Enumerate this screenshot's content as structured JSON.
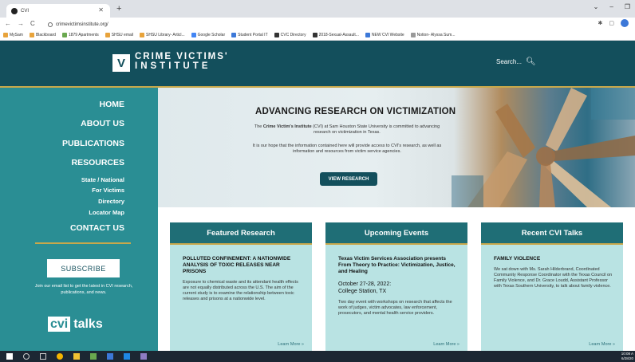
{
  "browser": {
    "tab_title": "CVI",
    "url": "crimevictimsinstitute.org/",
    "bookmarks": [
      "MySam",
      "Blackboard",
      "1879 Apartments",
      "SHSU email",
      "SHSU Library- Articl...",
      "Google Scholar",
      "Student Portal IT",
      "CVC Directory",
      "2018-Sexual-Assault...",
      "NEW CVI Website",
      "Notion- Alyssa Sum..."
    ]
  },
  "header": {
    "logo_line1": "CRIME VICTIMS'",
    "logo_line2": "INSTITUTE",
    "search_label": "Search..."
  },
  "sidebar": {
    "home": "HOME",
    "about": "ABOUT US",
    "publications": "PUBLICATIONS",
    "resources": "RESOURCES",
    "sub": [
      "State / National",
      "For Victims",
      "Directory",
      "Locator Map"
    ],
    "contact": "CONTACT US",
    "subscribe": "SUBSCRIBE",
    "join_text": "Join our email list to get the latest in CVI research, publications, and news.",
    "talks_logo_a": "cvi",
    "talks_logo_b": "talks"
  },
  "hero": {
    "title": "ADVANCING RESEARCH ON VICTIMIZATION",
    "line1_prefix": "The ",
    "line1_strong": "Crime Victim's Institute",
    "line1_suffix": " (CVI) at Sam Houston State University is committed to advancing research on victimization in Texas.",
    "line2": "It is our hope that the information contained here will provide access to CVI's research, as well as information and resources from victim service agencies.",
    "button": "VIEW RESEARCH"
  },
  "cards": {
    "featured": {
      "heading": "Featured Research",
      "title": "POLLUTED CONFINEMENT: A NATIONWIDE ANALYSIS OF TOXIC RELEASES NEAR PRISONS",
      "text": "Exposure to chemical waste and its attendant health effects are not equally distributed across the U.S. The aim of the current study is to examine the relationship between toxic releases and prisons at a nationwide level.",
      "link": "Learn More »"
    },
    "events": {
      "heading": "Upcoming Events",
      "title": "Texas Victim Services Association presents From Theory to Practice: Victimization, Justice, and Healing",
      "date_line1": "October 27-28, 2022:",
      "date_line2": "College Station, TX",
      "text": "Two day event with workshops on research that affects the work of judges, victim advocates, law enforcement, prosecutors, and mental health service providers.",
      "link": "Learn More »"
    },
    "talks": {
      "heading": "Recent CVI Talks",
      "title": "FAMILY VIOLENCE",
      "text": "We sat down with Ms. Sarah Hilderbrand, Coordinated Community Response Coordinator with the Texas Council on Family Violence, and Dr. Grace Loudd, Assistant Professor with Texas Southern University, to talk about family violence.",
      "link": "Learn More »"
    }
  },
  "taskbar": {
    "time": "10:08 A",
    "date": "6/28/20"
  }
}
